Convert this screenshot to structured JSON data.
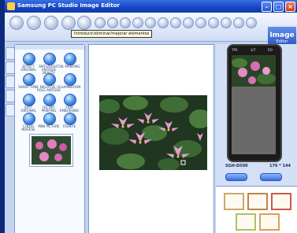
{
  "window": {
    "title": "Samsung PC Studio Image Editor"
  },
  "tooltip": {
    "text": "Introducir/eliminar/mejorar elementos"
  },
  "brand": {
    "line1": "Image",
    "line2": "Editor"
  },
  "toolbar": {
    "labels": [
      "",
      "",
      "",
      "",
      "",
      "",
      "",
      "",
      "",
      "",
      "",
      "",
      "",
      "",
      "",
      "",
      "",
      "",
      ""
    ]
  },
  "effects": [
    {
      "label": "EFFECT ORIGINAL"
    },
    {
      "label": "ANTI-ALIGHT ANTIQUE BEAUTY"
    },
    {
      "label": "OIL PAINTING"
    },
    {
      "label": "SHARP TONE"
    },
    {
      "label": "NEGATIVE / ROLE ANTIQUE"
    },
    {
      "label": "ILLUMINATION"
    },
    {
      "label": "SOFT ORIGINAL"
    },
    {
      "label": "OIL ART PAINTING"
    },
    {
      "label": "FILM EMBOSSING"
    },
    {
      "label": "COLOR INVERSE"
    },
    {
      "label": "MINI PICTURE"
    },
    {
      "label": "FISHEYE"
    }
  ],
  "device": {
    "model": "SGH-D500",
    "resolution": "176 * 144",
    "screen_header": [
      "TPS",
      "1/7",
      "RO"
    ]
  },
  "buttons": {
    "left": "",
    "right": ""
  },
  "colors": {
    "titlebar": "#1546c2",
    "panel": "#c4d4ef",
    "accent": "#3a6ee0"
  }
}
